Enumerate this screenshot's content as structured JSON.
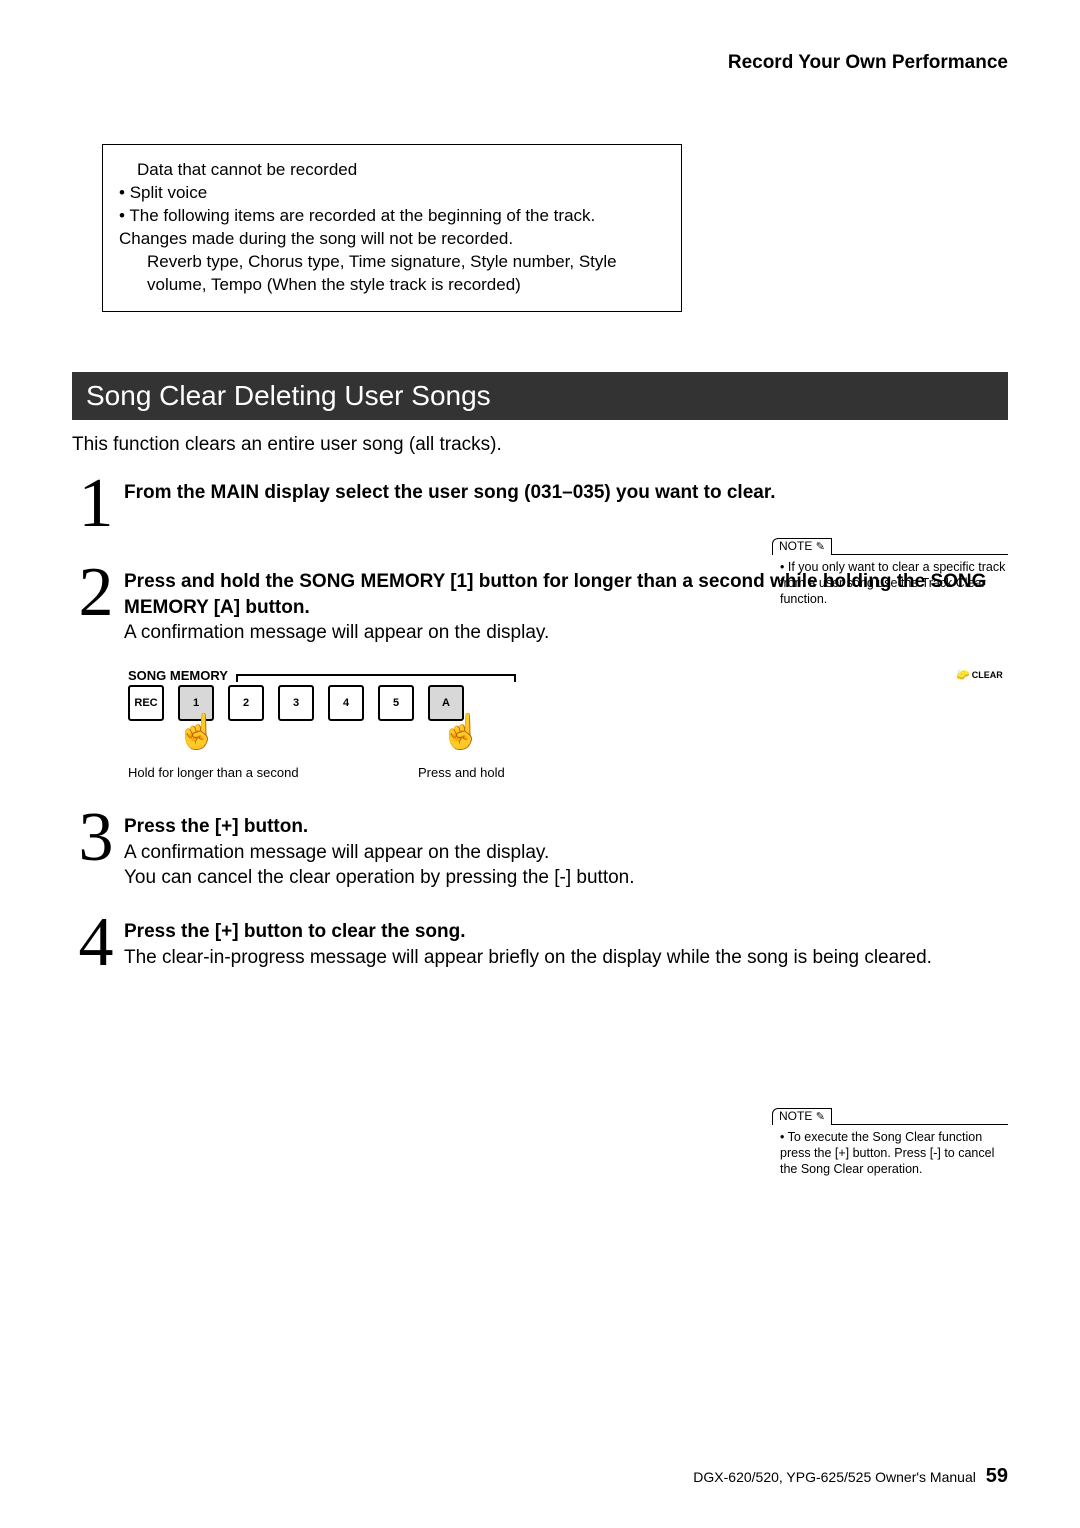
{
  "header": {
    "section_title": "Record Your Own Performance"
  },
  "info_box": {
    "title": "Data that cannot be recorded",
    "item1": "Split voice",
    "item2": "The following items are recorded at the beginning of the track. Changes made during the song will not be recorded.",
    "item2_sub": "Reverb type, Chorus type, Time signature, Style number, Style volume, Tempo (When the style track is recorded)"
  },
  "section_bar": "Song Clear Deleting User Songs",
  "intro": "This function clears an entire user song (all tracks).",
  "note1": {
    "label": "NOTE",
    "body": "If you only want to clear a speciﬁc track from a user song use the Track Clear function."
  },
  "steps": {
    "s1": {
      "num": "1",
      "bold": "From the MAIN display select the user song (031–035) you want to clear."
    },
    "s2": {
      "num": "2",
      "bold": "Press and hold the SONG MEMORY [1] button for longer than a second while holding the SONG MEMORY [A] button.",
      "plain": "A conﬁrmation message will appear on the display."
    },
    "s3": {
      "num": "3",
      "bold": "Press the [+] button.",
      "plain1": "A conﬁrmation message will appear on the display.",
      "plain2": "You can cancel the clear operation by pressing the [-] button."
    },
    "s4": {
      "num": "4",
      "bold": "Press the [+] button to clear the song.",
      "plain": "The clear-in-progress message will appear brieﬂy on the display while the song is being cleared."
    }
  },
  "diagram": {
    "heading": "SONG MEMORY",
    "clear_label": "CLEAR",
    "buttons": [
      "REC",
      "1",
      "2",
      "3",
      "4",
      "5",
      "A"
    ],
    "ann_left": "Hold for longer than a second",
    "ann_right": "Press and hold"
  },
  "note2": {
    "label": "NOTE",
    "body": "To execute the Song Clear function press the [+] button. Press [-] to cancel the Song Clear operation."
  },
  "footer": {
    "text": "DGX-620/520, YPG-625/525  Owner's Manual",
    "page": "59"
  }
}
